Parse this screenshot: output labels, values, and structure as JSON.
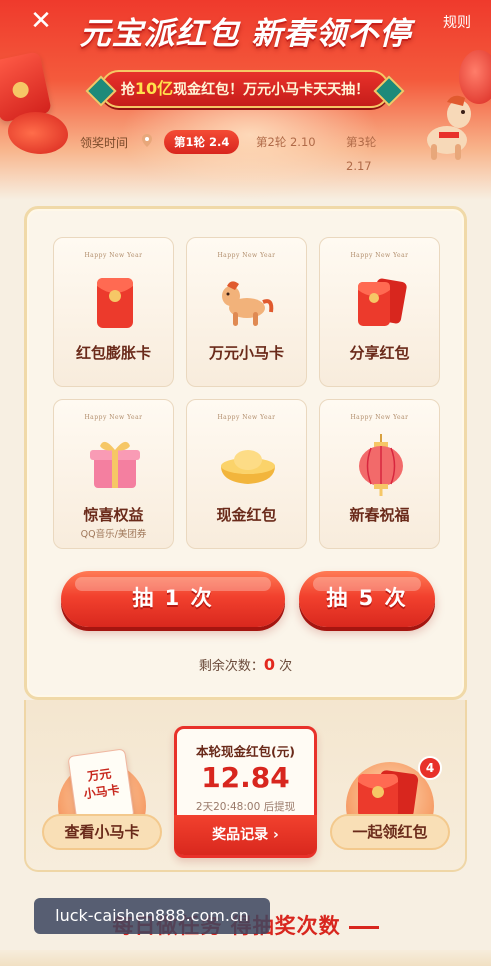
{
  "header": {
    "close_icon": "close-icon",
    "rules_label": "规则",
    "title": "元宝派红包 新春领不停",
    "banner": {
      "prefix": "抢",
      "highlight": "10亿",
      "suffix": "现金红包！万元小马卡天天抽！"
    },
    "rounds": {
      "label": "领奖时间",
      "items": [
        {
          "label": "第1轮 2.4",
          "active": true
        },
        {
          "label": "第2轮 2.10",
          "active": false
        },
        {
          "label": "第3轮 2.17",
          "active": false
        }
      ]
    }
  },
  "prizes": [
    {
      "tag": "Happy New Year",
      "name": "红包膨胀卡",
      "sub": "",
      "icon": "red-envelope-icon"
    },
    {
      "tag": "Happy New Year",
      "name": "万元小马卡",
      "sub": "",
      "icon": "horse-icon"
    },
    {
      "tag": "Happy New Year",
      "name": "分享红包",
      "sub": "",
      "icon": "envelopes-icon"
    },
    {
      "tag": "Happy New Year",
      "name": "惊喜权益",
      "sub": "QQ音乐/美团券",
      "icon": "gift-box-icon"
    },
    {
      "tag": "Happy New Year",
      "name": "现金红包",
      "sub": "",
      "icon": "gold-ingot-icon"
    },
    {
      "tag": "Happy New Year",
      "name": "新春祝福",
      "sub": "",
      "icon": "lantern-icon"
    }
  ],
  "draw": {
    "once_label": "抽 1 次",
    "five_label": "抽 5 次",
    "remaining_label": "剩余次数：",
    "remaining_count": "0",
    "remaining_unit": " 次"
  },
  "bottom": {
    "left_card_text_1": "万元",
    "left_card_text_2": "小马卡",
    "left_button": "查看小马卡",
    "cash_title": "本轮现金红包(元)",
    "cash_amount": "12.84",
    "cash_time": "2天20:48:00 后提现",
    "records_button": "奖品记录 ›",
    "right_badge": "4",
    "right_button": "一起领红包"
  },
  "footer": {
    "section_heading": "每日做任务 得抽奖次数",
    "watermark": "luck-caishen888.com.cn"
  },
  "colors": {
    "primary_red": "#e8312a",
    "gold": "#f6c766",
    "bg_cream": "#f7efe2"
  }
}
